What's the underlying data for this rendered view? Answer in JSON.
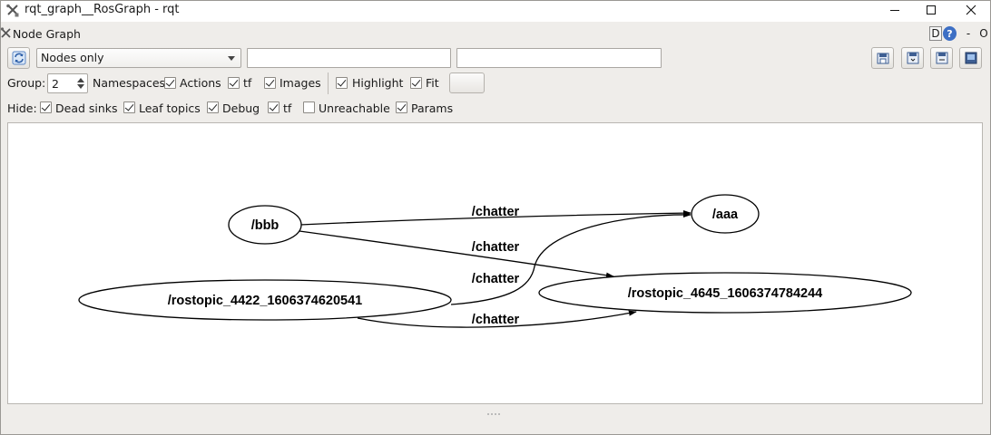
{
  "window": {
    "title": "rqt_graph__RosGraph - rqt",
    "minimize_label": "minimize",
    "maximize_label": "maximize",
    "close_label": "close"
  },
  "dock": {
    "title": "Node Graph",
    "help_d": "D",
    "help_q": "?",
    "minus": "-",
    "close": "O"
  },
  "toolbar": {
    "graph_mode": "Nodes only",
    "filter_in": "",
    "filter_ex": ""
  },
  "options": {
    "group_label": "Group:",
    "group_value": "2",
    "items": [
      {
        "label": "Namespaces",
        "checked": null
      },
      {
        "label": "Actions",
        "checked": true
      },
      {
        "label": "tf",
        "checked": true
      },
      {
        "label": "Images",
        "checked": true
      },
      {
        "label": "Highlight",
        "checked": true
      },
      {
        "label": "Fit",
        "checked": true
      }
    ]
  },
  "hide": {
    "label": "Hide:",
    "items": [
      {
        "label": "Dead sinks",
        "checked": true
      },
      {
        "label": "Leaf topics",
        "checked": true
      },
      {
        "label": "Debug",
        "checked": true
      },
      {
        "label": "tf",
        "checked": true
      },
      {
        "label": "Unreachable",
        "checked": false
      },
      {
        "label": "Params",
        "checked": true
      }
    ]
  },
  "graph": {
    "nodes": [
      {
        "id": "bbb",
        "label": "/bbb"
      },
      {
        "id": "aaa",
        "label": "/aaa"
      },
      {
        "id": "r4422",
        "label": "/rostopic_4422_1606374620541"
      },
      {
        "id": "r4645",
        "label": "/rostopic_4645_1606374784244"
      }
    ],
    "edges": [
      {
        "from": "bbb",
        "to": "aaa",
        "label": "/chatter"
      },
      {
        "from": "bbb",
        "to": "r4645",
        "label": "/chatter"
      },
      {
        "from": "r4422",
        "to": "aaa",
        "label": "/chatter"
      },
      {
        "from": "r4422",
        "to": "r4645",
        "label": "/chatter"
      }
    ]
  }
}
